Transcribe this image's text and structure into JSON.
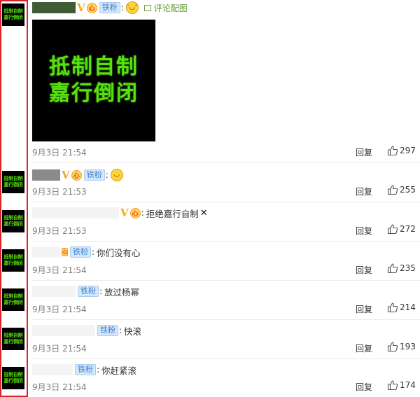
{
  "comments": [
    {
      "badge": "铁粉",
      "colon": ":",
      "time": "9月3日 21:54",
      "reply": "回复",
      "likes": "297",
      "pic_link": "评论配图",
      "avatar_lines": [
        "抵制自制",
        "嘉行倒闭"
      ],
      "image_lines": [
        "抵制自制",
        "嘉行倒闭"
      ]
    },
    {
      "badge": "铁粉",
      "colon": ":",
      "time": "9月3日 21:53",
      "reply": "回复",
      "likes": "255",
      "avatar_lines": [
        "抵制自制",
        "嘉行倒闭"
      ]
    },
    {
      "colon": ":",
      "text": "拒绝嘉行自制",
      "cross": "✕",
      "time": "9月3日 21:53",
      "reply": "回复",
      "likes": "272",
      "avatar_lines": [
        "抵制自制",
        "嘉行倒闭"
      ]
    },
    {
      "badge": "铁粉",
      "colon": ":",
      "text": "你们没有心",
      "time": "9月3日 21:54",
      "reply": "回复",
      "likes": "235",
      "avatar_lines": [
        "抵制自制",
        "嘉行倒闭"
      ]
    },
    {
      "badge": "铁粉",
      "colon": ":",
      "text": "放过杨幂",
      "time": "9月3日 21:54",
      "reply": "回复",
      "likes": "214",
      "avatar_lines": [
        "抵制自制",
        "嘉行倒闭"
      ]
    },
    {
      "badge": "铁粉",
      "colon": ":",
      "text": "快滚",
      "time": "9月3日 21:54",
      "reply": "回复",
      "likes": "193",
      "avatar_lines": [
        "抵制自制",
        "嘉行倒闭"
      ]
    },
    {
      "badge": "铁粉",
      "colon": ":",
      "text": "你赶紧滚",
      "time": "9月3日 21:54",
      "reply": "回复",
      "likes": "174",
      "avatar_lines": [
        "抵制自制",
        "嘉行倒闭"
      ]
    }
  ],
  "icons": {
    "vip": "V",
    "level": "心",
    "emoji_smirk": "ᵔ◡ᵔ",
    "emoji_smile": "◡",
    "thumb": "thumbs-up-outline-icon",
    "picture": "picture-icon"
  },
  "colors": {
    "highlight_frame": "#d8232a",
    "fan_badge": "#3b7fc9",
    "pic_link": "#5d9c37",
    "avatar_text": "#58e00f"
  }
}
